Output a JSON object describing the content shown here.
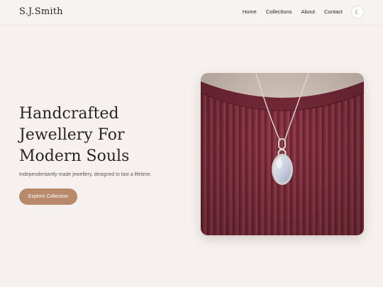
{
  "header": {
    "brand": "S.J.Smith",
    "nav": [
      "Home",
      "Collections",
      "About",
      "Contact"
    ],
    "theme_toggle_icon": "moon-icon",
    "theme_toggle_glyph": "☾"
  },
  "hero": {
    "title_lines": [
      "Handcrafted",
      "Jewellery For",
      "Modern Souls"
    ],
    "subtitle": "Independentantly made jewellery, designed to last a lifetime.",
    "cta_label": "Explore Collection"
  },
  "colors": {
    "background": "#f6f1ef",
    "accent": "#b88a6b",
    "text": "#2a2422",
    "sweater": "#8a3444"
  }
}
